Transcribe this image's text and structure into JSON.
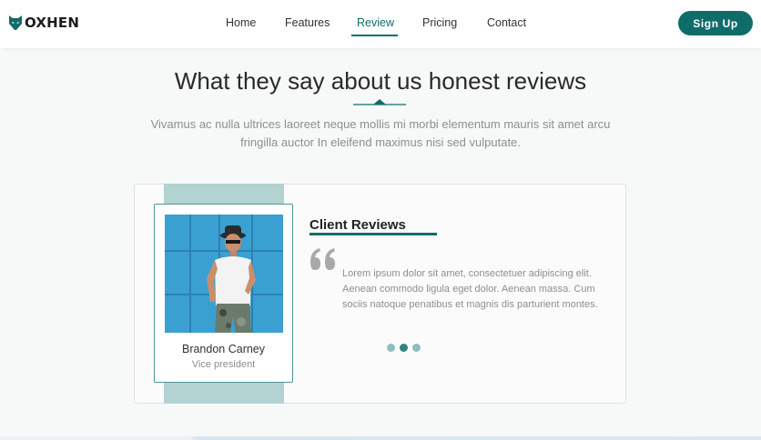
{
  "brand": {
    "name": "OXHEN",
    "accent_color": "#0f6d69",
    "logo_icon": "fox-head-icon"
  },
  "nav": {
    "items": [
      {
        "label": "Home"
      },
      {
        "label": "Features"
      },
      {
        "label": "Review"
      },
      {
        "label": "Pricing"
      },
      {
        "label": "Contact"
      }
    ],
    "active": "Review",
    "signup_label": "Sign Up"
  },
  "section": {
    "title": "What they say about us honest reviews",
    "subtitle": "Vivamus ac nulla ultrices laoreet neque mollis mi morbi elementum mauris sit amet arcu fringilla auctor In eleifend maximus nisi sed vulputate."
  },
  "testimonial": {
    "heading": "Client Reviews",
    "quote_icon": "quote-icon",
    "text": "Lorem ipsum dolor sit amet, consectetuer adipiscing elit. Aenean commodo ligula eget dolor. Aenean massa. Cum sociis natoque penatibus et magnis dis parturient montes.",
    "person": {
      "name": "Brandon Carney",
      "role": "Vice president"
    },
    "slider": {
      "total": 3,
      "active_index": 1
    }
  }
}
